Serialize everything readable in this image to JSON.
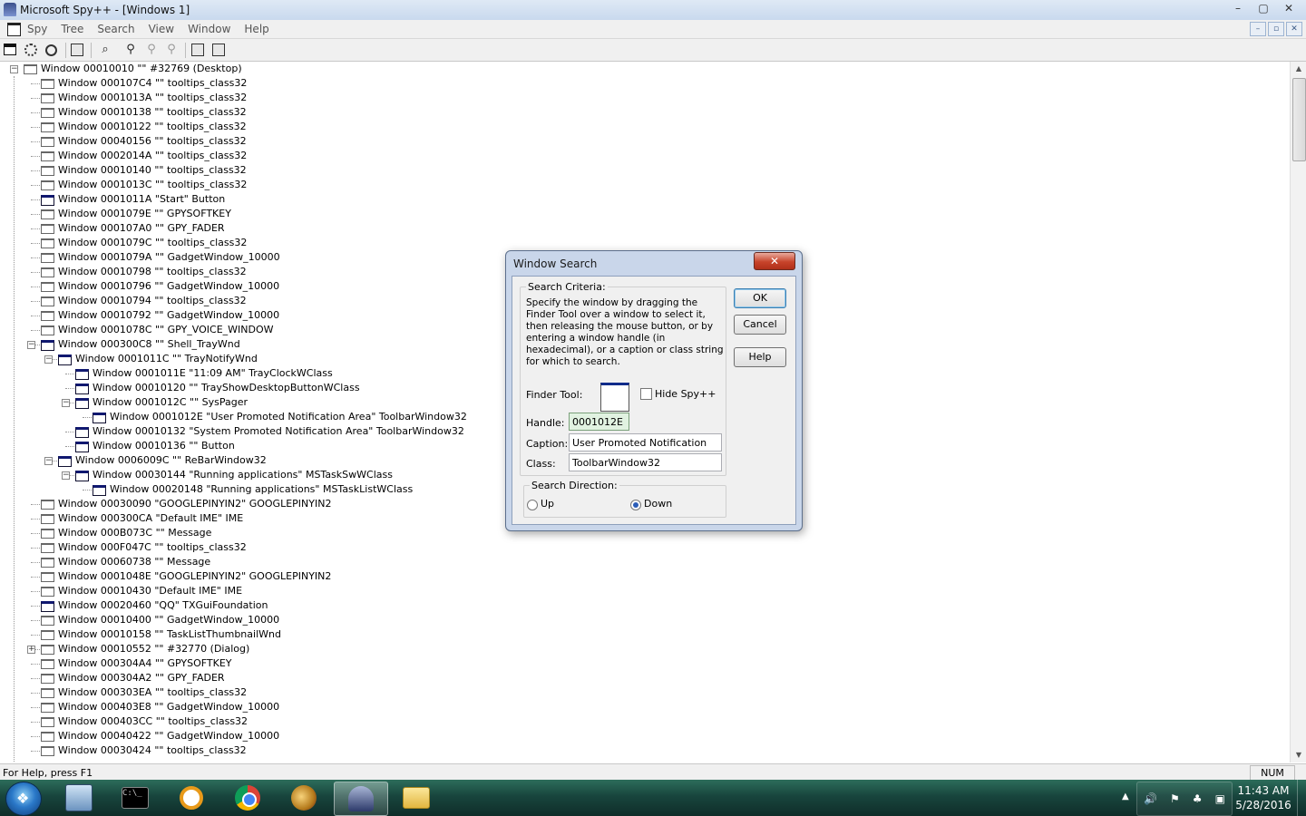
{
  "window": {
    "title": "Microsoft Spy++ - [Windows 1]",
    "controls": [
      "–",
      "▢",
      "✕"
    ]
  },
  "menu": {
    "items": [
      "Spy",
      "Tree",
      "Search",
      "View",
      "Window",
      "Help"
    ],
    "mdi_controls": [
      "–",
      "▫",
      "✕"
    ]
  },
  "toolbar": {
    "icons": [
      "windows-icon",
      "processes-icon",
      "threads-icon",
      "log-messages-icon",
      "find-window-icon",
      "find-next-icon",
      "find-prev-icon",
      "properties-icon",
      "refresh-icon"
    ]
  },
  "tree": {
    "rows": [
      {
        "text": "Window 00010010 \"\" #32769 (Desktop)",
        "depth": 0,
        "expander": "-",
        "visible": false
      },
      {
        "text": "Window 000107C4 \"\" tooltips_class32",
        "depth": 1,
        "expander": "",
        "visible": false
      },
      {
        "text": "Window 0001013A \"\" tooltips_class32",
        "depth": 1,
        "expander": "",
        "visible": false
      },
      {
        "text": "Window 00010138 \"\" tooltips_class32",
        "depth": 1,
        "expander": "",
        "visible": false
      },
      {
        "text": "Window 00010122 \"\" tooltips_class32",
        "depth": 1,
        "expander": "",
        "visible": false
      },
      {
        "text": "Window 00040156 \"\" tooltips_class32",
        "depth": 1,
        "expander": "",
        "visible": false
      },
      {
        "text": "Window 0002014A \"\" tooltips_class32",
        "depth": 1,
        "expander": "",
        "visible": false
      },
      {
        "text": "Window 00010140 \"\" tooltips_class32",
        "depth": 1,
        "expander": "",
        "visible": false
      },
      {
        "text": "Window 0001013C \"\" tooltips_class32",
        "depth": 1,
        "expander": "",
        "visible": false
      },
      {
        "text": "Window 0001011A \"Start\" Button",
        "depth": 1,
        "expander": "",
        "visible": true
      },
      {
        "text": "Window 0001079E \"\" GPYSOFTKEY",
        "depth": 1,
        "expander": "",
        "visible": false
      },
      {
        "text": "Window 000107A0 \"\" GPY_FADER",
        "depth": 1,
        "expander": "",
        "visible": false
      },
      {
        "text": "Window 0001079C \"\" tooltips_class32",
        "depth": 1,
        "expander": "",
        "visible": false
      },
      {
        "text": "Window 0001079A \"\" GadgetWindow_10000",
        "depth": 1,
        "expander": "",
        "visible": false
      },
      {
        "text": "Window 00010798 \"\" tooltips_class32",
        "depth": 1,
        "expander": "",
        "visible": false
      },
      {
        "text": "Window 00010796 \"\" GadgetWindow_10000",
        "depth": 1,
        "expander": "",
        "visible": false
      },
      {
        "text": "Window 00010794 \"\" tooltips_class32",
        "depth": 1,
        "expander": "",
        "visible": false
      },
      {
        "text": "Window 00010792 \"\" GadgetWindow_10000",
        "depth": 1,
        "expander": "",
        "visible": false
      },
      {
        "text": "Window 0001078C \"\" GPY_VOICE_WINDOW",
        "depth": 1,
        "expander": "",
        "visible": false
      },
      {
        "text": "Window 000300C8 \"\" Shell_TrayWnd",
        "depth": 1,
        "expander": "-",
        "visible": true
      },
      {
        "text": "Window 0001011C \"\" TrayNotifyWnd",
        "depth": 2,
        "expander": "-",
        "visible": true
      },
      {
        "text": "Window 0001011E \"11:09 AM\" TrayClockWClass",
        "depth": 3,
        "expander": "",
        "visible": true
      },
      {
        "text": "Window 00010120 \"\" TrayShowDesktopButtonWClass",
        "depth": 3,
        "expander": "",
        "visible": true
      },
      {
        "text": "Window 0001012C \"\" SysPager",
        "depth": 3,
        "expander": "-",
        "visible": true
      },
      {
        "text": "Window 0001012E \"User Promoted Notification Area\" ToolbarWindow32",
        "depth": 4,
        "expander": "",
        "visible": true
      },
      {
        "text": "Window 00010132 \"System Promoted Notification Area\" ToolbarWindow32",
        "depth": 3,
        "expander": "",
        "visible": true
      },
      {
        "text": "Window 00010136 \"\" Button",
        "depth": 3,
        "expander": "",
        "visible": true
      },
      {
        "text": "Window 0006009C \"\" ReBarWindow32",
        "depth": 2,
        "expander": "-",
        "visible": true
      },
      {
        "text": "Window 00030144 \"Running applications\" MSTaskSwWClass",
        "depth": 3,
        "expander": "-",
        "visible": true
      },
      {
        "text": "Window 00020148 \"Running applications\" MSTaskListWClass",
        "depth": 4,
        "expander": "",
        "visible": true
      },
      {
        "text": "Window 00030090 \"GOOGLEPINYIN2\" GOOGLEPINYIN2",
        "depth": 1,
        "expander": "",
        "visible": false
      },
      {
        "text": "Window 000300CA \"Default IME\" IME",
        "depth": 1,
        "expander": "",
        "visible": false
      },
      {
        "text": "Window 000B073C \"\" Message",
        "depth": 1,
        "expander": "",
        "visible": false
      },
      {
        "text": "Window 000F047C \"\" tooltips_class32",
        "depth": 1,
        "expander": "",
        "visible": false
      },
      {
        "text": "Window 00060738 \"\" Message",
        "depth": 1,
        "expander": "",
        "visible": false
      },
      {
        "text": "Window 0001048E \"GOOGLEPINYIN2\" GOOGLEPINYIN2",
        "depth": 1,
        "expander": "",
        "visible": false
      },
      {
        "text": "Window 00010430 \"Default IME\" IME",
        "depth": 1,
        "expander": "",
        "visible": false
      },
      {
        "text": "Window 00020460 \"QQ\" TXGuiFoundation",
        "depth": 1,
        "expander": "",
        "visible": true
      },
      {
        "text": "Window 00010400 \"\" GadgetWindow_10000",
        "depth": 1,
        "expander": "",
        "visible": false
      },
      {
        "text": "Window 00010158 \"\" TaskListThumbnailWnd",
        "depth": 1,
        "expander": "",
        "visible": false
      },
      {
        "text": "Window 00010552 \"\" #32770 (Dialog)",
        "depth": 1,
        "expander": "+",
        "visible": false
      },
      {
        "text": "Window 000304A4 \"\" GPYSOFTKEY",
        "depth": 1,
        "expander": "",
        "visible": false
      },
      {
        "text": "Window 000304A2 \"\" GPY_FADER",
        "depth": 1,
        "expander": "",
        "visible": false
      },
      {
        "text": "Window 000303EA \"\" tooltips_class32",
        "depth": 1,
        "expander": "",
        "visible": false
      },
      {
        "text": "Window 000403E8 \"\" GadgetWindow_10000",
        "depth": 1,
        "expander": "",
        "visible": false
      },
      {
        "text": "Window 000403CC \"\" tooltips_class32",
        "depth": 1,
        "expander": "",
        "visible": false
      },
      {
        "text": "Window 00040422 \"\" GadgetWindow_10000",
        "depth": 1,
        "expander": "",
        "visible": false
      },
      {
        "text": "Window 00030424 \"\" tooltips_class32",
        "depth": 1,
        "expander": "",
        "visible": false
      }
    ]
  },
  "status": {
    "help": "For Help, press F1",
    "num": "NUM"
  },
  "dialog": {
    "title": "Window Search",
    "close": "✕",
    "criteria_legend": "Search Criteria:",
    "description": "Specify the window by dragging the Finder Tool over a window to select it, then releasing the mouse button, or by entering a window handle (in hexadecimal), or a caption or class string for which to search.",
    "finder_label": "Finder Tool:",
    "hide_label": "Hide Spy++",
    "hide_checked": false,
    "handle_label": "Handle:",
    "handle_value": "0001012E",
    "caption_label": "Caption:",
    "caption_value": "User Promoted Notification Area",
    "class_label": "Class:",
    "class_value": "ToolbarWindow32",
    "direction_legend": "Search Direction:",
    "up_label": "Up",
    "down_label": "Down",
    "direction": "Down",
    "ok": "OK",
    "cancel": "Cancel",
    "help": "Help"
  },
  "taskbar": {
    "start": "❖",
    "cmd_text": "C:\\_",
    "apps": [
      "computer-icon",
      "cmd-icon",
      "magnifier-icon",
      "chrome-icon",
      "spartan-icon",
      "spy-icon",
      "folder-icon"
    ],
    "active_app": "spy-icon",
    "tray_chevron": "▲",
    "tray_icons": [
      "🔊",
      "⚑",
      "♣",
      "▣"
    ],
    "time": "11:43 AM",
    "date": "5/28/2016"
  }
}
